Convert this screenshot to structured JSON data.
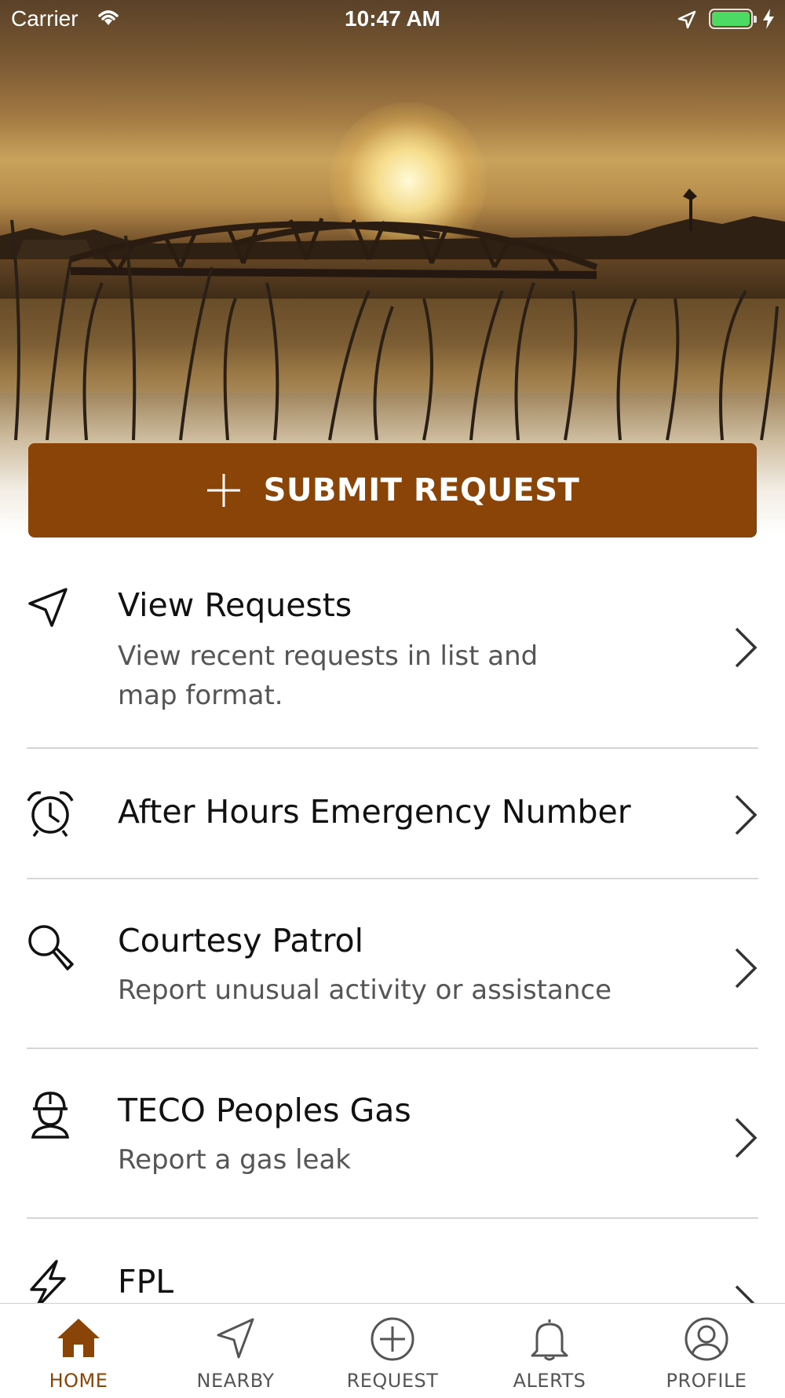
{
  "status_bar": {
    "carrier": "Carrier",
    "time": "10:47 AM",
    "battery_level": 1.0
  },
  "hero": {
    "image": "sunset-bridge-over-wetland"
  },
  "submit_button": {
    "label": "SUBMIT REQUEST",
    "icon": "plus-icon",
    "color": "#8b4408"
  },
  "menu": {
    "items": [
      {
        "icon": "navigation-arrow-icon",
        "title": "View Requests",
        "subtitle": "View recent requests in list and map format."
      },
      {
        "icon": "alarm-clock-icon",
        "title": "After Hours Emergency Number",
        "subtitle": ""
      },
      {
        "icon": "magnifier-icon",
        "title": "Courtesy Patrol",
        "subtitle": "Report unusual activity or assistance"
      },
      {
        "icon": "hardhat-worker-icon",
        "title": "TECO Peoples Gas",
        "subtitle": "Report a gas leak"
      },
      {
        "icon": "lightning-bolt-icon",
        "title": "FPL",
        "subtitle": ""
      }
    ]
  },
  "tab_bar": {
    "active": "HOME",
    "active_color": "#8b4408",
    "tabs": [
      {
        "label": "HOME",
        "icon": "home-icon"
      },
      {
        "label": "NEARBY",
        "icon": "navigation-arrow-icon"
      },
      {
        "label": "REQUEST",
        "icon": "plus-circle-icon"
      },
      {
        "label": "ALERTS",
        "icon": "bell-icon"
      },
      {
        "label": "PROFILE",
        "icon": "user-circle-icon"
      }
    ]
  }
}
